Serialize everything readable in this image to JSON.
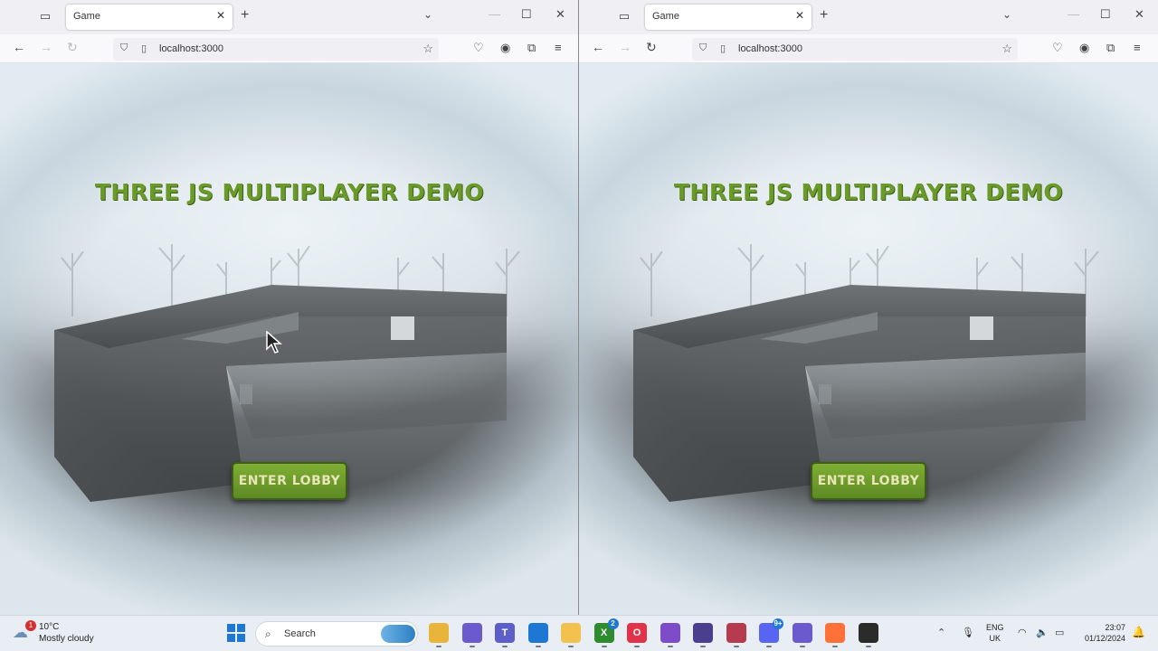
{
  "windows": [
    {
      "id": "left",
      "tab_title": "Game",
      "url": "localhost:3000",
      "game_title": "Three JS Multiplayer Demo",
      "enter_button": "Enter Lobby"
    },
    {
      "id": "right",
      "tab_title": "Game",
      "url": "localhost:3000",
      "game_title": "Three JS Multiplayer Demo",
      "enter_button": "Enter Lobby"
    }
  ],
  "browser_icons": {
    "tab_list": "tab-list-icon",
    "close_tab": "close-icon",
    "new_tab": "plus-icon",
    "back": "back-arrow-icon",
    "forward": "forward-arrow-icon",
    "reload": "reload-icon",
    "bookmark": "star-icon",
    "menu": "hamburger-menu-icon"
  },
  "taskbar": {
    "weather": {
      "temperature": "10°C",
      "description": "Mostly cloudy",
      "badge": "1"
    },
    "search_placeholder": "Search",
    "apps": [
      {
        "name": "file-explorer",
        "label": "",
        "color": "#e9b43a"
      },
      {
        "name": "copilot",
        "label": "",
        "color": "#6a5acd"
      },
      {
        "name": "teams",
        "label": "T",
        "color": "#5b5fc7"
      },
      {
        "name": "mail",
        "label": "",
        "color": "#1f77d4"
      },
      {
        "name": "folder",
        "label": "",
        "color": "#f2c14e"
      },
      {
        "name": "xbox",
        "label": "X",
        "color": "#2e8b2e",
        "badge": "2"
      },
      {
        "name": "opera",
        "label": "O",
        "color": "#e0334a"
      },
      {
        "name": "github-desktop",
        "label": "",
        "color": "#7e4bc9"
      },
      {
        "name": "obs",
        "label": "",
        "color": "#4a3f8f"
      },
      {
        "name": "davinci",
        "label": "",
        "color": "#b53b4e"
      },
      {
        "name": "discord",
        "label": "",
        "color": "#5865f2",
        "badge": "9+"
      },
      {
        "name": "clapper",
        "label": "",
        "color": "#6a5acd"
      },
      {
        "name": "firefox",
        "label": "",
        "color": "#ff7139"
      },
      {
        "name": "chrome",
        "label": "",
        "color": "#2b2b2b"
      }
    ],
    "tray": {
      "lang_line1": "ENG",
      "lang_line2": "UK",
      "time": "23:07",
      "date": "01/12/2024"
    }
  },
  "colors": {
    "title_green": "#6a9a2a",
    "button_green": "#6a9a2a",
    "button_text": "#e8e6b8",
    "taskbar_bg": "#e9eef4"
  }
}
